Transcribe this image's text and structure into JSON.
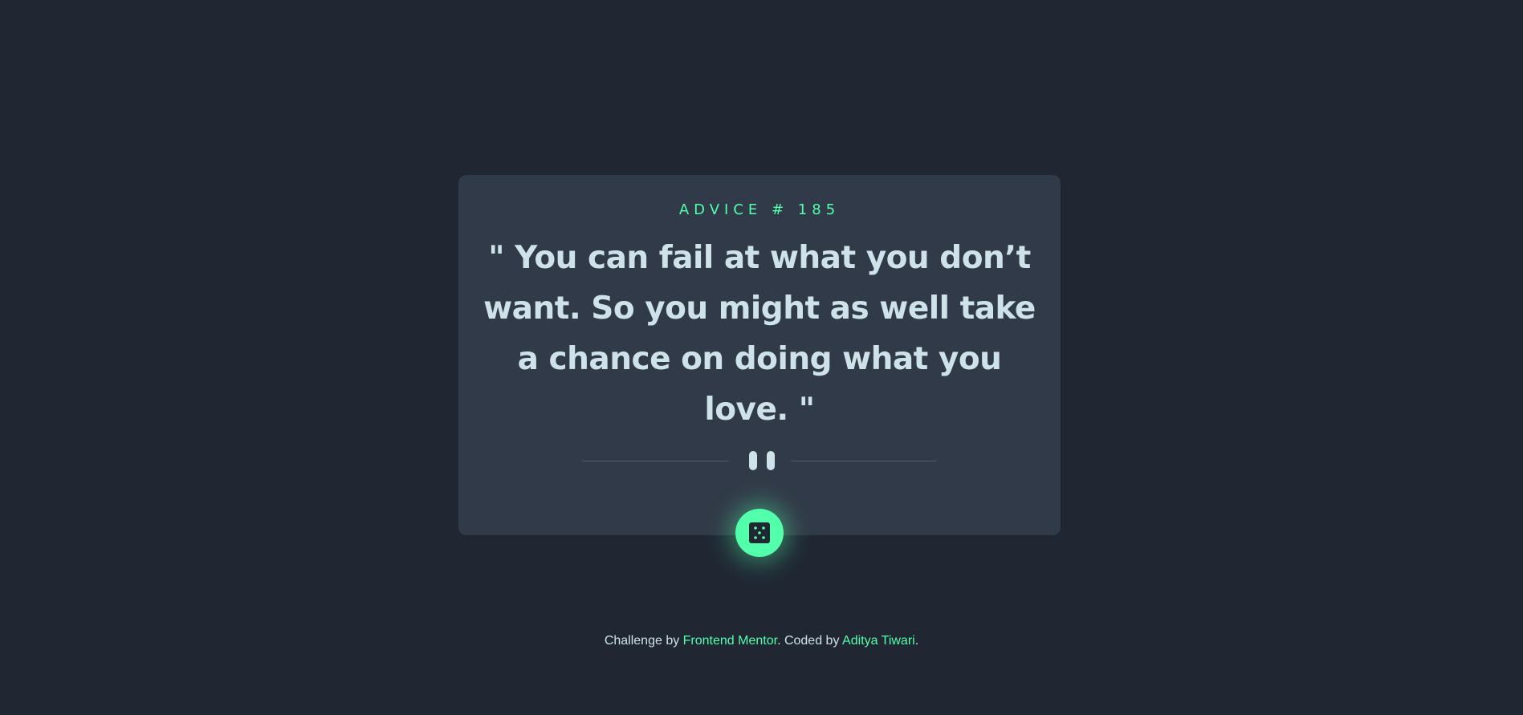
{
  "card": {
    "advice_label": "ADVICE # 185",
    "quote": "\" You can fail at what you don’t want. So you might as well take a chance on doing what you love. \""
  },
  "dice_button": {
    "icon": "dice-icon"
  },
  "footer": {
    "challenge_prefix": "Challenge by ",
    "challenge_link": "Frontend Mentor",
    "coded_by_prefix": ". Coded by ",
    "author_link": "Aditya Tiwari",
    "suffix": "."
  },
  "colors": {
    "background": "#202733",
    "card": "#313a48",
    "accent": "#53ffaa",
    "text": "#cee3e9",
    "divider": "#4f5d74"
  }
}
